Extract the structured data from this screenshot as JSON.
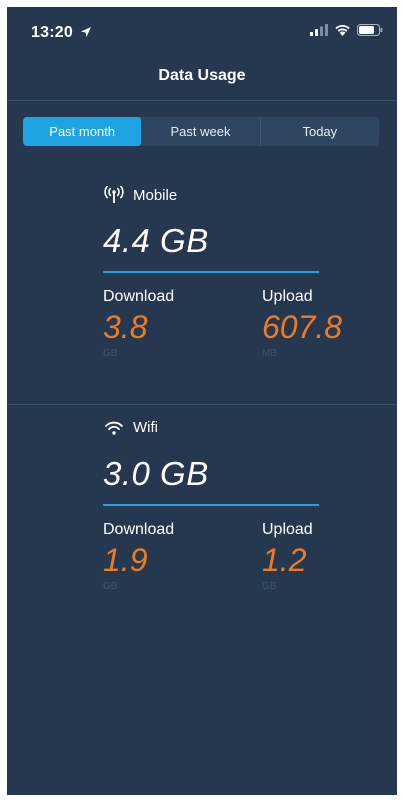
{
  "status_bar": {
    "time": "13:20",
    "icons": [
      "location-arrow-icon",
      "cellular-signal-icon",
      "wifi-icon",
      "battery-icon"
    ]
  },
  "nav": {
    "title": "Data Usage"
  },
  "segments": [
    {
      "label": "Past month",
      "active": true
    },
    {
      "label": "Past week",
      "active": false
    },
    {
      "label": "Today",
      "active": false
    }
  ],
  "mobile": {
    "icon": "cellular-antenna-icon",
    "title": "Mobile",
    "total": "4.4 GB",
    "download": {
      "label": "Download",
      "value": "3.8",
      "unit": "GB"
    },
    "upload": {
      "label": "Upload",
      "value": "607.8",
      "unit": "MB"
    }
  },
  "wifi": {
    "icon": "wifi-icon",
    "title": "Wifi",
    "total": "3.0 GB",
    "download": {
      "label": "Download",
      "value": "1.9",
      "unit": "GB"
    },
    "upload": {
      "label": "Upload",
      "value": "1.2",
      "unit": "GB"
    }
  },
  "colors": {
    "background": "#25384f",
    "accent_blue": "#1ea4e2",
    "accent_orange": "#ef7b21",
    "muted_unit": "#3e5571"
  }
}
